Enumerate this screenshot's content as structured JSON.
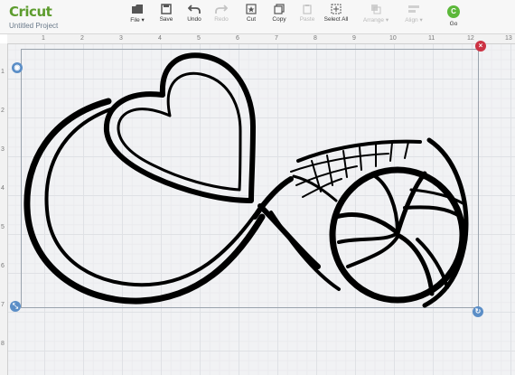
{
  "app": {
    "logo": "Cricut",
    "project_title": "Untitled Project"
  },
  "toolbar": {
    "file": "File",
    "save": "Save",
    "undo": "Undo",
    "redo": "Redo",
    "cut": "Cut",
    "copy": "Copy",
    "paste": "Paste",
    "select_all": "Select All",
    "arrange": "Arrange",
    "align": "Align",
    "go_letter": "C",
    "go": "Go"
  },
  "ruler": {
    "h_ticks": [
      "1",
      "2",
      "3",
      "4",
      "5",
      "6",
      "7",
      "8",
      "9",
      "10",
      "11",
      "12",
      "13"
    ],
    "v_ticks": [
      "1",
      "2",
      "3",
      "4",
      "5",
      "6",
      "7",
      "8"
    ]
  },
  "colors": {
    "accent_green": "#5cb83a",
    "logo_green": "#5d9c2e",
    "handle_blue": "#5b8ec7",
    "handle_red": "#cc3344"
  },
  "icons": {
    "file": "folder-icon",
    "save": "save-icon",
    "undo": "undo-icon",
    "redo": "redo-icon",
    "cut": "cut-icon",
    "copy": "copy-icon",
    "paste": "paste-icon",
    "select_all": "select-all-icon",
    "arrange": "arrange-icon",
    "align": "align-icon",
    "delete_handle": "close-icon",
    "rotate_handle": "rotate-icon",
    "resize_handle": "resize-icon",
    "layer_handle": "layer-icon"
  }
}
